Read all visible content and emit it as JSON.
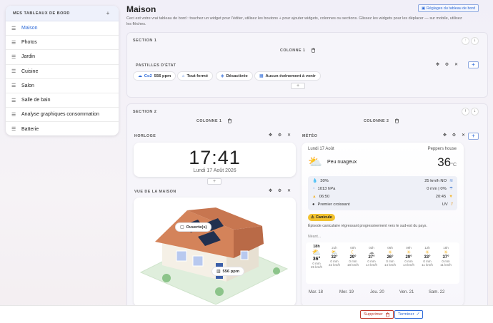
{
  "sidebar": {
    "title": "MES TABLEAUX DE BORD",
    "add": "+",
    "items": [
      {
        "label": "Maison",
        "active": true
      },
      {
        "label": "Photos"
      },
      {
        "label": "Jardin"
      },
      {
        "label": "Cuisine"
      },
      {
        "label": "Salon"
      },
      {
        "label": "Salle de bain"
      },
      {
        "label": "Analyse graphiques consommation"
      },
      {
        "label": "Batterie"
      }
    ]
  },
  "header": {
    "title": "Maison",
    "intro": "Ceci est votre vrai tableau de bord : touchez un widget pour l'éditer, utilisez les boutons + pour ajouter widgets, colonnes ou sections. Glissez les widgets pour les déplacer — sur mobile, utilisez les flèches.",
    "settings_label": "Réglages du tableau de bord"
  },
  "section1": {
    "title": "SECTION 1",
    "column": "COLONNE 1",
    "widget_label": "PASTILLES D'ÉTAT",
    "pills": [
      {
        "label": "Co2",
        "value": "556 ppm"
      },
      {
        "label": "Tout fermé"
      },
      {
        "label": "Désactivée"
      },
      {
        "label": "Aucun événement à venir"
      }
    ]
  },
  "section2": {
    "title": "SECTION 2",
    "col1": "COLONNE 1",
    "col2": "COLONNE 2",
    "clock_label": "HORLOGE",
    "meteo_label": "MÉTÉO",
    "house_label": "VUE DE LA MAISON"
  },
  "clock": {
    "time": "17:41",
    "date": "Lundi 17 Août 2026"
  },
  "house": {
    "badge_open": "Ouverte(s)",
    "badge_co2": "556 ppm"
  },
  "weather": {
    "date": "Lundi 17 Août",
    "location": "Peppers house",
    "condition": "Peu nuageux",
    "temp": "36",
    "unit": "°C",
    "humidity": "30%",
    "wind": "25 km/h NO",
    "pressure": "1013 hPa",
    "rain": "0 mm | 0%",
    "sunrise": "06:50",
    "sunset": "20:45",
    "moon": "Premier croissant",
    "uv_label": "UV",
    "uv": "7",
    "alert": "Canicule",
    "alert_text": "Épisode caniculaire régressant progressivement vers le sud-est du pays.",
    "alert_more": "Néant...",
    "hourly": [
      {
        "h": "18h",
        "t": "36°",
        "r": "0 mm",
        "w": "25 km/h"
      },
      {
        "h": "21h",
        "t": "32°",
        "r": "0 mm",
        "w": "22 km/h"
      },
      {
        "h": "00h",
        "t": "29°",
        "r": "0 mm",
        "w": "18 km/h"
      },
      {
        "h": "03h",
        "t": "27°",
        "r": "0 mm",
        "w": "14 km/h"
      },
      {
        "h": "06h",
        "t": "26°",
        "r": "0 mm",
        "w": "14 km/h"
      },
      {
        "h": "09h",
        "t": "29°",
        "r": "0 mm",
        "w": "14 km/h"
      },
      {
        "h": "12h",
        "t": "33°",
        "r": "0 mm",
        "w": "11 km/h"
      },
      {
        "h": "15h",
        "t": "37°",
        "r": "0 mm",
        "w": "11 km/h"
      }
    ],
    "days": [
      "Mar. 18",
      "Mer. 19",
      "Jeu. 20",
      "Ven. 21",
      "Sam. 22"
    ]
  },
  "footer": {
    "delete": "Supprimer",
    "done": "Terminer"
  },
  "colors": {
    "accent": "#2f6bd8",
    "danger": "#c0392b",
    "alert": "#f2c230"
  }
}
